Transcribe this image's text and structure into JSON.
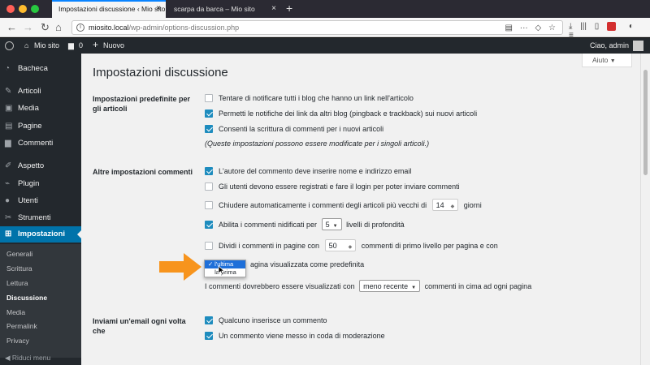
{
  "browser": {
    "tabs": [
      {
        "title": "Impostazioni discussione ‹ Mio sito",
        "active": true
      },
      {
        "title": "scarpa da barca – Mio sito",
        "active": false
      }
    ],
    "url_host": "miosito.local",
    "url_path": "/wp-admin/options-discussion.php"
  },
  "adminbar": {
    "site_name": "Mio sito",
    "comments_count": "0",
    "new_label": "Nuovo",
    "greeting": "Ciao, admin"
  },
  "sidebar": {
    "items": [
      {
        "label": "Bacheca",
        "icon": "dashboard-icon"
      },
      {
        "label": "Articoli",
        "icon": "pin-icon"
      },
      {
        "label": "Media",
        "icon": "media-icon"
      },
      {
        "label": "Pagine",
        "icon": "page-icon"
      },
      {
        "label": "Commenti",
        "icon": "comment-icon"
      },
      {
        "label": "Aspetto",
        "icon": "brush-icon"
      },
      {
        "label": "Plugin",
        "icon": "plugin-icon"
      },
      {
        "label": "Utenti",
        "icon": "user-icon"
      },
      {
        "label": "Strumenti",
        "icon": "wrench-icon"
      },
      {
        "label": "Impostazioni",
        "icon": "settings-icon"
      }
    ],
    "submenu": [
      "Generali",
      "Scrittura",
      "Lettura",
      "Discussione",
      "Media",
      "Permalink",
      "Privacy"
    ],
    "collapse_label": "Riduci menu"
  },
  "main": {
    "help_label": "Aiuto",
    "title": "Impostazioni discussione",
    "section1": {
      "label": "Impostazioni predefinite per gli articoli",
      "opt1": "Tentare di notificare tutti i blog che hanno un link nell'articolo",
      "opt2": "Permetti le notifiche dei link da altri blog (pingback e trackback) sui nuovi articoli",
      "opt3": "Consenti la scrittura di commenti per i nuovi articoli",
      "note": "(Queste impostazioni possono essere modificate per i singoli articoli.)"
    },
    "section2": {
      "label": "Altre impostazioni commenti",
      "opt1": "L'autore del commento deve inserire nome e indirizzo email",
      "opt2": "Gli utenti devono essere registrati e fare il login per poter inviare commenti",
      "opt3_pre": "Chiudere automaticamente i commenti degli articoli più vecchi di",
      "opt3_value": "14",
      "opt3_post": "giorni",
      "opt4_pre": "Abilita i commenti nidificati per",
      "opt4_value": "5",
      "opt4_post": "livelli di profondità",
      "opt5_pre": "Dividi i commenti in pagine con",
      "opt5_value": "50",
      "opt5_post": "commenti di primo livello per pagina e con",
      "opt6_post": "agina visualizzata come predefinita",
      "opt7_pre": "I commenti dovrebbero essere visualizzati con",
      "opt7_value": "meno recente",
      "opt7_post": "commenti in cima ad ogni pagina",
      "dropdown_options": [
        "l'ultima",
        "la prima"
      ]
    },
    "section3": {
      "label": "Inviami un'email ogni volta che",
      "opt1": "Qualcuno inserisce un commento",
      "opt2": "Un commento viene messo in coda di moderazione"
    }
  },
  "colors": {
    "accent": "#0073aa",
    "highlight_arrow": "#f7941d"
  }
}
